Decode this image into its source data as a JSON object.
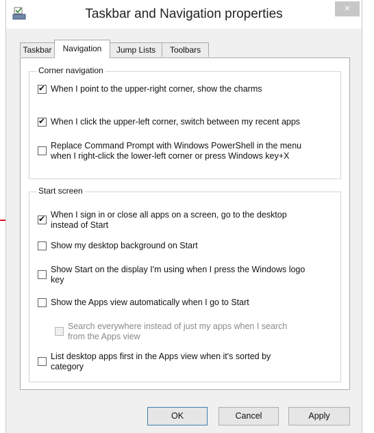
{
  "window": {
    "title": "Taskbar and Navigation properties",
    "close_glyph": "×"
  },
  "tabs": [
    {
      "label": "Taskbar",
      "active": false
    },
    {
      "label": "Navigation",
      "active": true
    },
    {
      "label": "Jump Lists",
      "active": false
    },
    {
      "label": "Toolbars",
      "active": false
    }
  ],
  "corner_navigation": {
    "title": "Corner navigation",
    "options": [
      {
        "label": "When I point to the upper-right corner, show the charms",
        "checked": true
      },
      {
        "label": "When I click the upper-left corner, switch between my recent apps",
        "checked": true
      },
      {
        "label_line1": "Replace Command Prompt with Windows PowerShell in the menu",
        "label_line2": "when I right-click the lower-left corner or press Windows key+X",
        "checked": false
      }
    ]
  },
  "start_screen": {
    "title": "Start screen",
    "options": [
      {
        "label_line1": "When I sign in or close all apps on a screen, go to the desktop",
        "label_line2": "instead of Start",
        "checked": true
      },
      {
        "label": "Show my desktop background on Start",
        "checked": false
      },
      {
        "label_line1": "Show Start on the display I'm using when I press the Windows logo",
        "label_line2": "key",
        "checked": false
      },
      {
        "label": "Show the Apps view automatically when I go to Start",
        "checked": false
      },
      {
        "label_line1": "Search everywhere instead of just my apps when I search",
        "label_line2": "from the Apps view",
        "checked": false,
        "disabled": true
      },
      {
        "label_line1": "List desktop apps first in the Apps view when it's sorted by",
        "label_line2": "category",
        "checked": false
      }
    ]
  },
  "buttons": {
    "ok": "OK",
    "cancel": "Cancel",
    "apply": "Apply"
  },
  "colors": {
    "annotation_arrow": "#e0141e",
    "default_button_border": "#3c7fb1"
  },
  "icons": {
    "app": "taskbar-properties-icon",
    "close": "close-icon",
    "annotation": "red-arrow-icon"
  }
}
